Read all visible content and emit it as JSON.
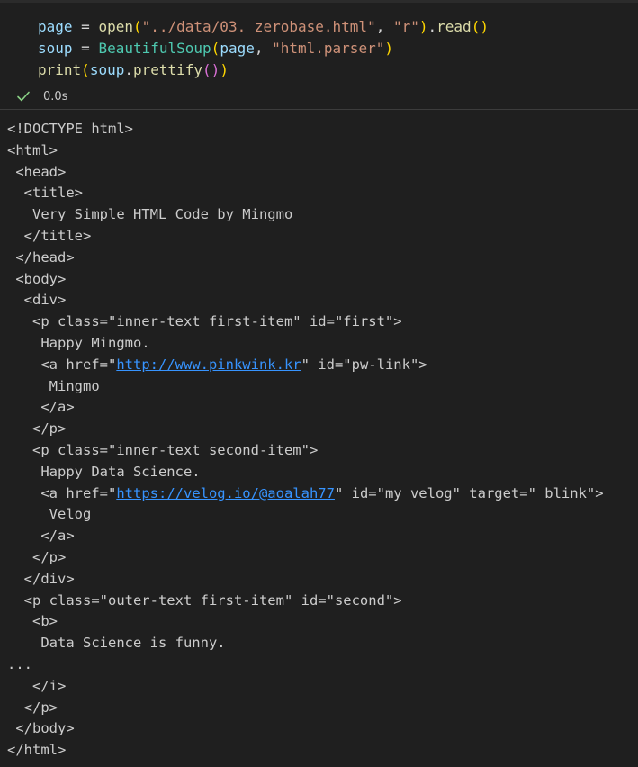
{
  "code": {
    "line1": {
      "var": "page",
      "eq": " = ",
      "fn": "open",
      "p1": "(",
      "s1": "\"../data/03. zerobase.html\"",
      "comma": ", ",
      "s2": "\"r\"",
      "p2": ")",
      "dot": ".",
      "fn2": "read",
      "p3": "()"
    },
    "line2": {
      "var": "soup",
      "eq": " = ",
      "cls": "BeautifulSoup",
      "p1": "(",
      "arg": "page",
      "comma": ", ",
      "s1": "\"html.parser\"",
      "p2": ")"
    },
    "line3": {
      "fn": "print",
      "p1": "(",
      "var": "soup",
      "dot": ".",
      "fn2": "prettify",
      "p2": "()",
      "p3": ")"
    }
  },
  "status": {
    "icon": "check-icon",
    "time": "0.0s",
    "color": "#89d185"
  },
  "output": {
    "lines": [
      "<!DOCTYPE html>",
      "<html>",
      " <head>",
      "  <title>",
      "   Very Simple HTML Code by Mingmo",
      "  </title>",
      " </head>",
      " <body>",
      "  <div>",
      "   <p class=\"inner-text first-item\" id=\"first\">",
      "    Happy Mingmo.",
      {
        "pre": "    <a href=\"",
        "link": "http://www.pinkwink.kr",
        "post": "\" id=\"pw-link\">"
      },
      "     Mingmo",
      "    </a>",
      "   </p>",
      "   <p class=\"inner-text second-item\">",
      "    Happy Data Science.",
      {
        "pre": "    <a href=\"",
        "link": "https://velog.io/@aoalah77",
        "post": "\" id=\"my_velog\" target=\"_blink\">"
      },
      "     Velog",
      "    </a>",
      "   </p>",
      "  </div>",
      "  <p class=\"outer-text first-item\" id=\"second\">",
      "   <b>",
      "    Data Science is funny.",
      "...",
      "   </i>",
      "  </p>",
      " </body>",
      "</html>"
    ]
  }
}
